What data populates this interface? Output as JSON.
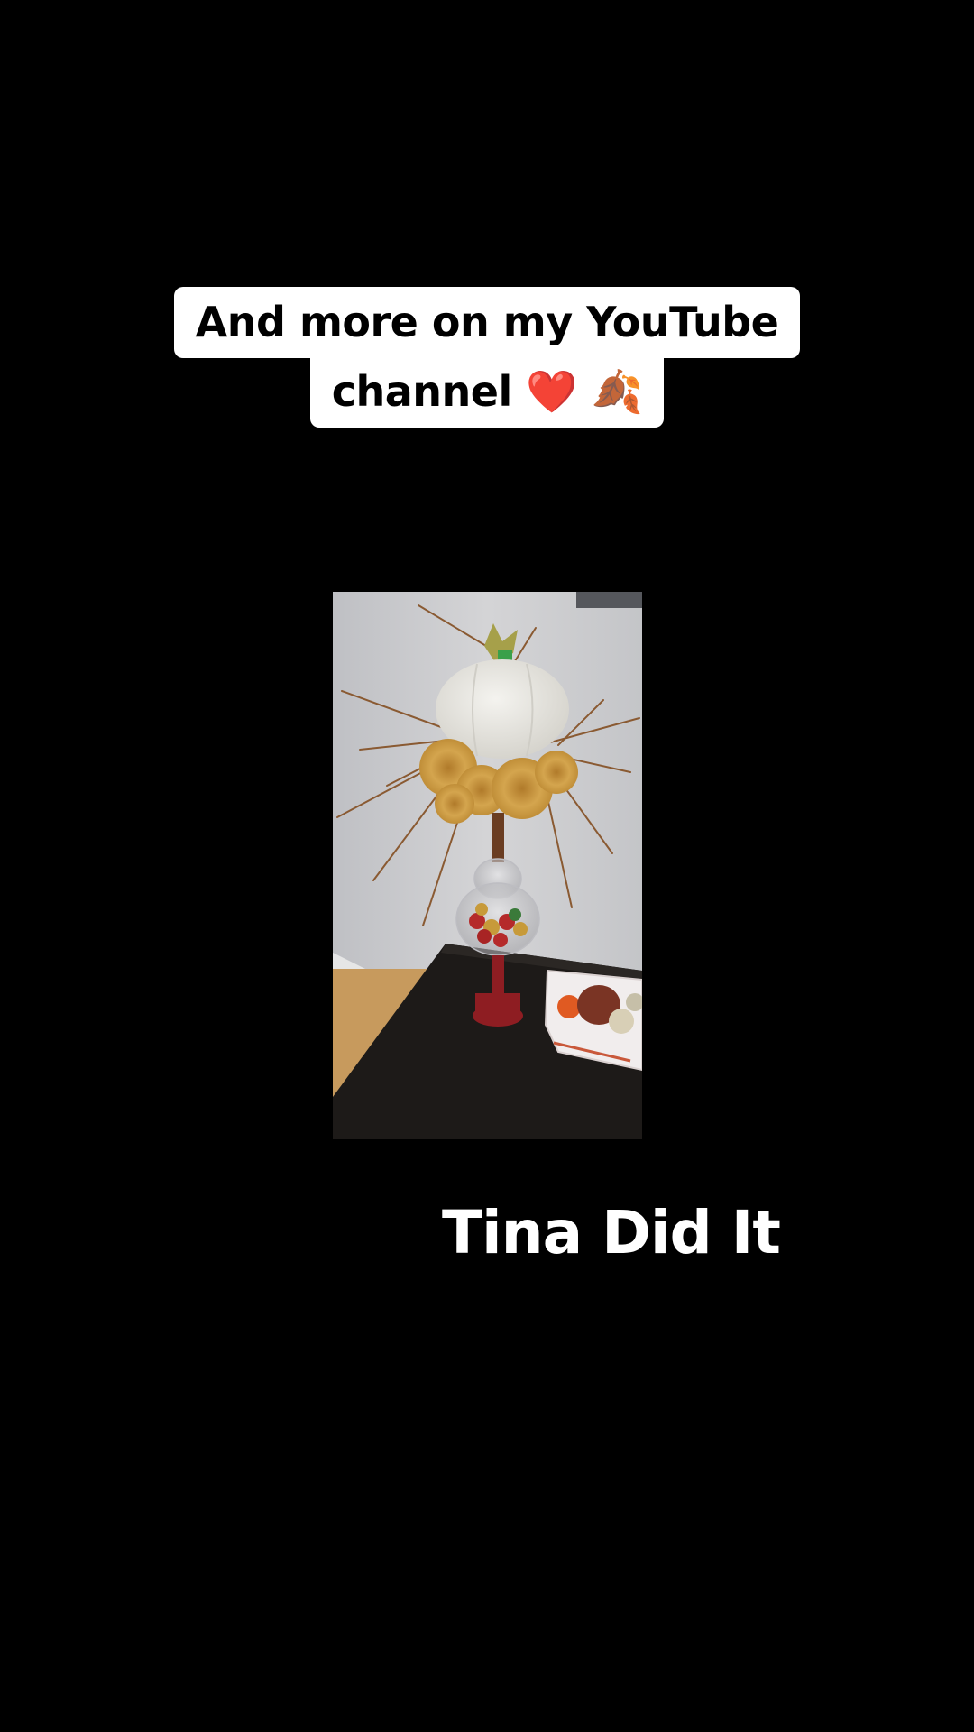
{
  "caption": {
    "line1": "And more on my YouTube",
    "line2": "channel ❤️ 🍂"
  },
  "video": {
    "label": "decorated white pumpkin topiary video"
  },
  "watermark": {
    "text": "Tina Did It"
  },
  "colors": {
    "background": "#000000",
    "caption_bg": "#ffffff",
    "caption_text": "#000000",
    "watermark_text": "#ffffff"
  }
}
